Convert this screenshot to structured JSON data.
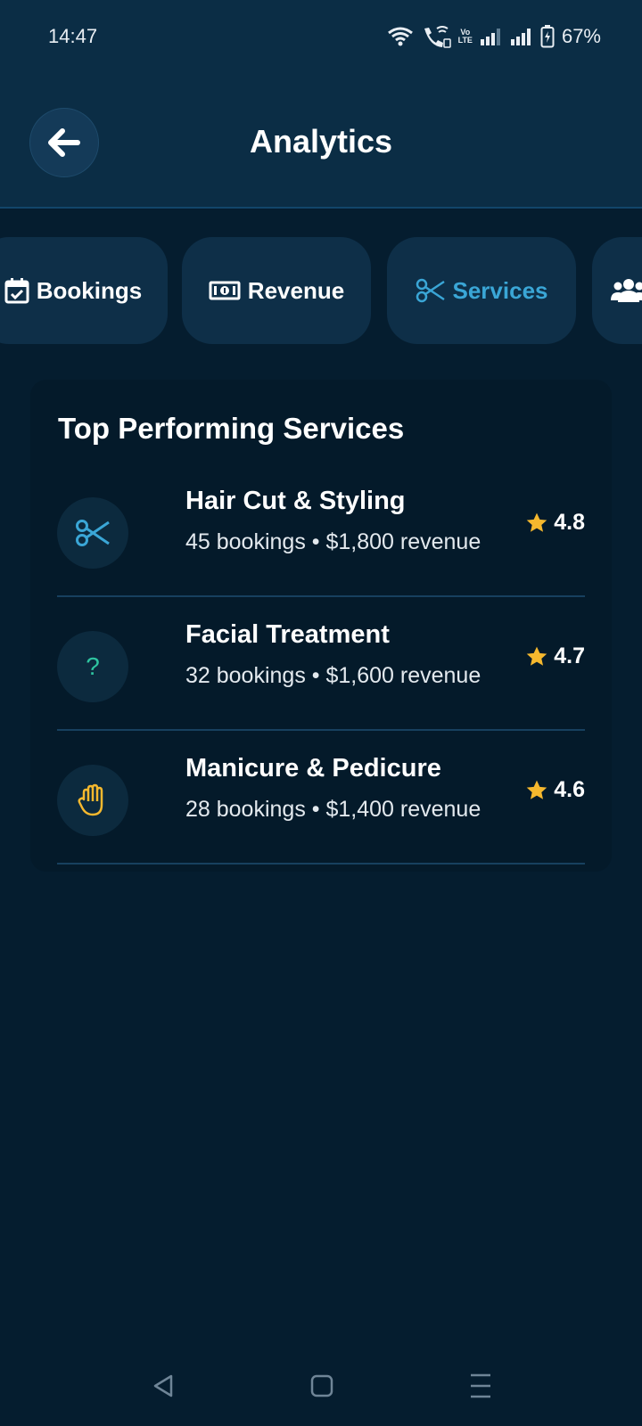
{
  "status_bar": {
    "time": "14:47",
    "volte_top": "Vo",
    "volte_bottom": "LTE",
    "battery": "67%"
  },
  "header": {
    "title": "Analytics",
    "back_icon": "arrow-left-icon"
  },
  "tabs": [
    {
      "label": "Bookings",
      "icon": "calendar-check-icon",
      "active": false
    },
    {
      "label": "Revenue",
      "icon": "money-bill-icon",
      "active": false
    },
    {
      "label": "Services",
      "icon": "scissors-icon",
      "active": true
    },
    {
      "label": "",
      "icon": "users-icon",
      "active": false
    }
  ],
  "card": {
    "title": "Top Performing Services",
    "services": [
      {
        "name": "Hair Cut & Styling",
        "meta": "45 bookings • $1,800 revenue",
        "rating": "4.8",
        "icon": "scissors-icon"
      },
      {
        "name": "Facial Treatment",
        "meta": "32 bookings • $1,600 revenue",
        "rating": "4.7",
        "icon": "question-icon"
      },
      {
        "name": "Manicure & Pedicure",
        "meta": "28 bookings • $1,400 revenue",
        "rating": "4.6",
        "icon": "hand-icon"
      }
    ]
  },
  "colors": {
    "background": "#051d2f",
    "header": "#0b2d45",
    "accent": "#3aa6d6",
    "star": "#f5b82e",
    "question_icon": "#2ec4a0",
    "hand_icon": "#f5b82e"
  },
  "nav": {
    "back_icon": "triangle-back-icon",
    "home_icon": "square-home-icon",
    "recents_icon": "menu-lines-icon"
  }
}
